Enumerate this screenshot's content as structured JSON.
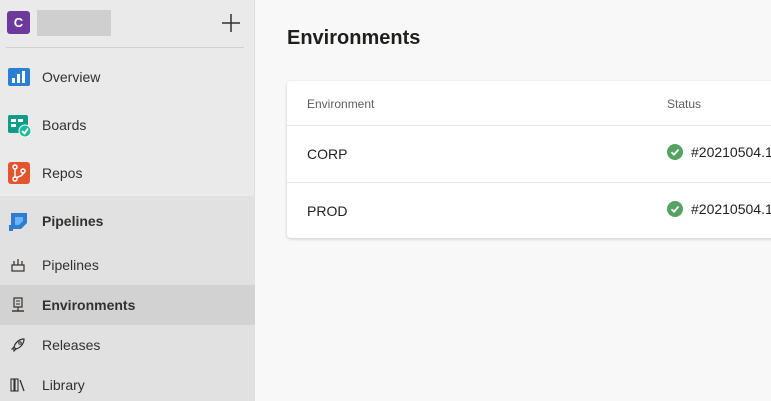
{
  "project": {
    "avatar_letter": "C"
  },
  "sidebar": {
    "items": [
      {
        "label": "Overview"
      },
      {
        "label": "Boards"
      },
      {
        "label": "Repos"
      },
      {
        "label": "Pipelines"
      }
    ],
    "sub_items": [
      {
        "label": "Pipelines"
      },
      {
        "label": "Environments"
      },
      {
        "label": "Releases"
      },
      {
        "label": "Library"
      }
    ]
  },
  "main": {
    "title": "Environments",
    "table": {
      "columns": [
        "Environment",
        "Status"
      ],
      "rows": [
        {
          "environment": "CORP",
          "status": "#20210504.1"
        },
        {
          "environment": "PROD",
          "status": "#20210504.1"
        }
      ]
    }
  },
  "colors": {
    "accent": "#6d3a9c",
    "success": "#55a362",
    "selected_bg": "#d2d2d2"
  }
}
